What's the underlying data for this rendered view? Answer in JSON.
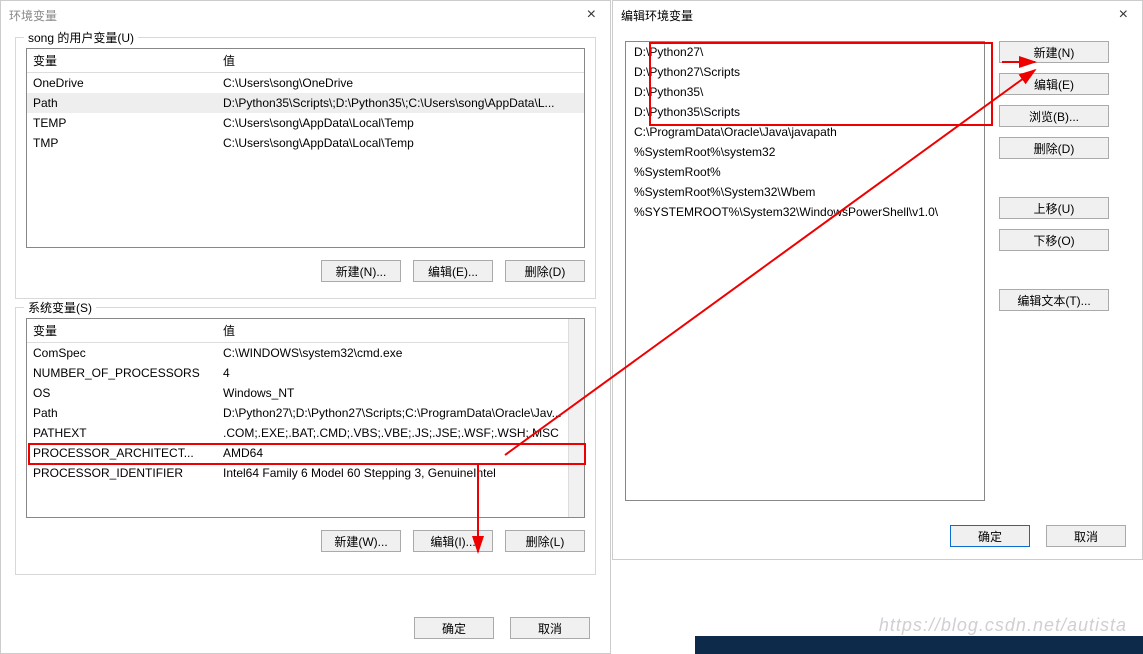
{
  "left_dialog": {
    "title": "环境变量",
    "close": "×",
    "user_group_label": "song 的用户变量(U)",
    "sys_group_label": "系统变量(S)",
    "columns": {
      "name": "变量",
      "value": "值"
    },
    "user_vars": [
      {
        "name": "OneDrive",
        "value": "C:\\Users\\song\\OneDrive"
      },
      {
        "name": "Path",
        "value": "D:\\Python35\\Scripts\\;D:\\Python35\\;C:\\Users\\song\\AppData\\L..."
      },
      {
        "name": "TEMP",
        "value": "C:\\Users\\song\\AppData\\Local\\Temp"
      },
      {
        "name": "TMP",
        "value": "C:\\Users\\song\\AppData\\Local\\Temp"
      }
    ],
    "sys_vars": [
      {
        "name": "ComSpec",
        "value": "C:\\WINDOWS\\system32\\cmd.exe"
      },
      {
        "name": "NUMBER_OF_PROCESSORS",
        "value": "4"
      },
      {
        "name": "OS",
        "value": "Windows_NT"
      },
      {
        "name": "Path",
        "value": "D:\\Python27\\;D:\\Python27\\Scripts;C:\\ProgramData\\Oracle\\Jav..."
      },
      {
        "name": "PATHEXT",
        "value": ".COM;.EXE;.BAT;.CMD;.VBS;.VBE;.JS;.JSE;.WSF;.WSH;.MSC"
      },
      {
        "name": "PROCESSOR_ARCHITECT...",
        "value": "AMD64"
      },
      {
        "name": "PROCESSOR_IDENTIFIER",
        "value": "Intel64 Family 6 Model 60 Stepping 3, GenuineIntel"
      }
    ],
    "user_buttons": {
      "new": "新建(N)...",
      "edit": "编辑(E)...",
      "delete": "删除(D)"
    },
    "sys_buttons": {
      "new": "新建(W)...",
      "edit": "编辑(I)...",
      "delete": "删除(L)"
    },
    "footer": {
      "ok": "确定",
      "cancel": "取消"
    }
  },
  "right_dialog": {
    "title": "编辑环境变量",
    "close": "×",
    "items": [
      "D:\\Python27\\",
      "D:\\Python27\\Scripts",
      "D:\\Python35\\",
      "D:\\Python35\\Scripts",
      "C:\\ProgramData\\Oracle\\Java\\javapath",
      "%SystemRoot%\\system32",
      "%SystemRoot%",
      "%SystemRoot%\\System32\\Wbem",
      "%SYSTEMROOT%\\System32\\WindowsPowerShell\\v1.0\\"
    ],
    "buttons": {
      "new": "新建(N)",
      "edit": "编辑(E)",
      "browse": "浏览(B)...",
      "delete": "删除(D)",
      "moveup": "上移(U)",
      "movedown": "下移(O)",
      "edittext": "编辑文本(T)..."
    },
    "footer": {
      "ok": "确定",
      "cancel": "取消"
    }
  },
  "watermark": "https://blog.csdn.net/autista"
}
